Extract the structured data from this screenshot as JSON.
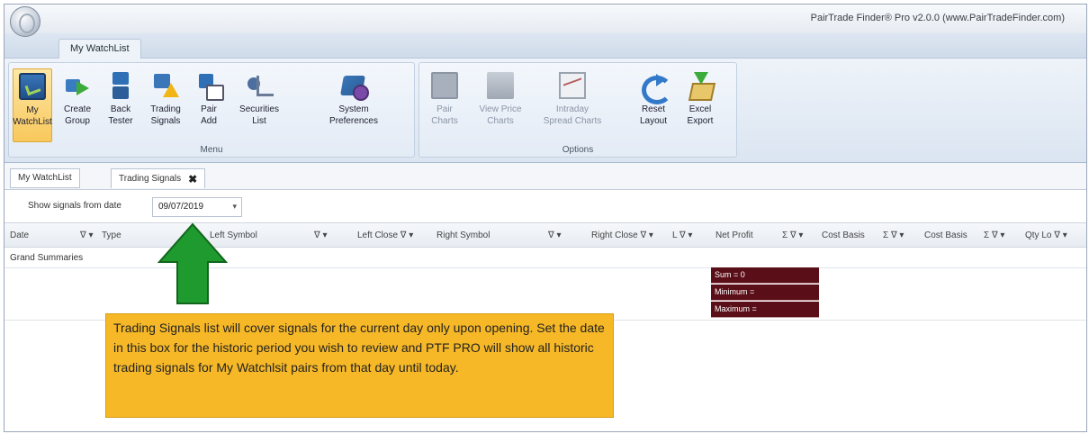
{
  "window": {
    "title": "PairTrade Finder® Pro v2.0.0 (www.PairTradeFinder.com)"
  },
  "ribbon": {
    "tab": "My WatchList",
    "groups": {
      "menu": {
        "label": "Menu",
        "buttons": [
          {
            "label": "My\nWatchList",
            "icon": "watchlist-icon"
          },
          {
            "label": "Create\nGroup",
            "icon": "create-group-icon"
          },
          {
            "label": "Back\nTester",
            "icon": "back-tester-icon"
          },
          {
            "label": "Trading\nSignals",
            "icon": "trading-signals-icon"
          },
          {
            "label": "Pair\nAdd",
            "icon": "pair-add-icon"
          },
          {
            "label": "Securities\nList",
            "icon": "securities-list-icon"
          },
          {
            "label": "System\nPreferences",
            "icon": "system-preferences-icon"
          }
        ]
      },
      "options": {
        "label": "Options",
        "buttons": [
          {
            "label": "Pair\nCharts",
            "icon": "pair-charts-icon"
          },
          {
            "label": "View Price\nCharts",
            "icon": "view-price-charts-icon"
          },
          {
            "label": "Intraday\nSpread Charts",
            "icon": "intraday-spread-charts-icon"
          },
          {
            "label": "Reset\nLayout",
            "icon": "reset-layout-icon"
          },
          {
            "label": "Excel\nExport",
            "icon": "excel-export-icon"
          }
        ]
      }
    }
  },
  "doc_tabs": [
    {
      "label": "My WatchList"
    },
    {
      "label": "Trading Signals",
      "close": "✖"
    }
  ],
  "filter": {
    "label": "Show signals from date",
    "date_value": "09/07/2019",
    "dropdown_glyph": "▾"
  },
  "grid": {
    "columns": [
      "Date",
      "∇ ▾",
      "Type",
      "Left Symbol",
      "∇ ▾",
      "Left Close ∇ ▾",
      "Right Symbol",
      "∇ ▾",
      "Right Close ∇ ▾",
      "L ∇ ▾",
      "Net Profit",
      "Σ ∇ ▾",
      "Cost Basis",
      "Σ ∇ ▾",
      "Cost Basis",
      "Σ ∇ ▾",
      "Qty Lo ∇ ▾"
    ],
    "summaries_label": "Grand Summaries",
    "summary_cells": [
      "Sum = 0",
      "Minimum =",
      "Maximum ="
    ]
  },
  "callout": {
    "text": "Trading Signals list will cover signals for the current day only upon opening.  Set the date in this box for the historic period you wish to review and PTF PRO will show all historic trading signals for My Watchlsit pairs from that day until today."
  },
  "colors": {
    "arrow": "#1f9a2f",
    "callout_bg": "#f6b827",
    "summary_bg": "#5a0f18",
    "active_button": "#f8c85c"
  }
}
